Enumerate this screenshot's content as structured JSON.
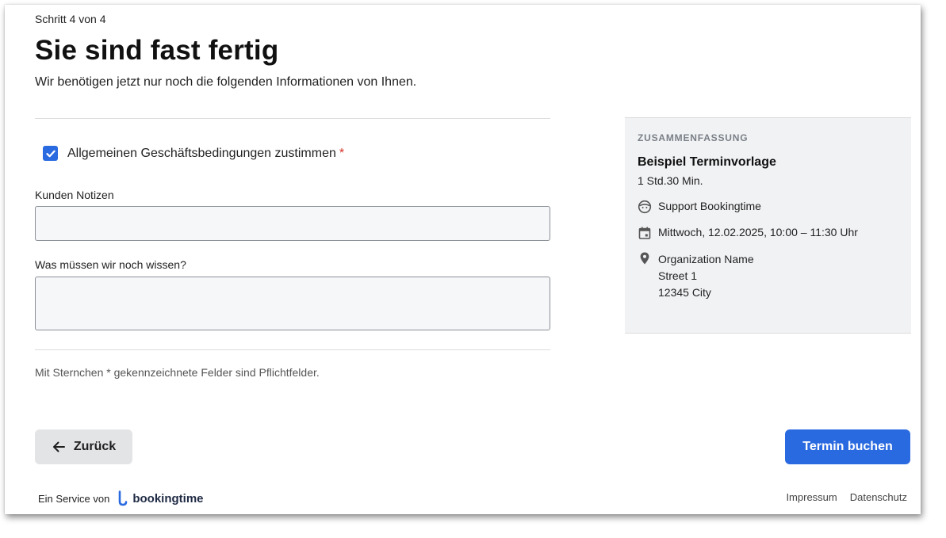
{
  "header": {
    "step": "Schritt 4 von 4",
    "title": "Sie sind fast fertig",
    "subtitle": "Wir benötigen jetzt nur noch die folgenden Informationen von Ihnen."
  },
  "form": {
    "agb_label": "Allgemeinen Geschäftsbedingungen zustimmen",
    "agb_required_mark": "*",
    "agb_checked": true,
    "notes_label": "Kunden Notizen",
    "notes_value": "",
    "extra_label": "Was müssen wir noch wissen?",
    "extra_value": "",
    "hint": "Mit Sternchen * gekennzeichnete Felder sind Pflichtfelder."
  },
  "summary": {
    "heading": "ZUSAMMENFASSUNG",
    "title": "Beispiel Terminvorlage",
    "duration": "1 Std.30 Min.",
    "staff": "Support Bookingtime",
    "datetime": "Mittwoch, 12.02.2025, 10:00 – 11:30 Uhr",
    "address": [
      "Organization Name",
      "Street 1",
      "12345 City"
    ],
    "icons": {
      "staff": "face-icon",
      "datetime": "calendar-icon",
      "address": "location-pin-icon"
    }
  },
  "actions": {
    "back_label": "Zurück",
    "book_label": "Termin buchen"
  },
  "footer": {
    "service_text": "Ein Service von",
    "brand": "bookingtime",
    "imprint": "Impressum",
    "privacy": "Datenschutz"
  },
  "colors": {
    "accent": "#2a6ae0",
    "required": "#d93025",
    "summary_bg": "#f1f2f4"
  }
}
